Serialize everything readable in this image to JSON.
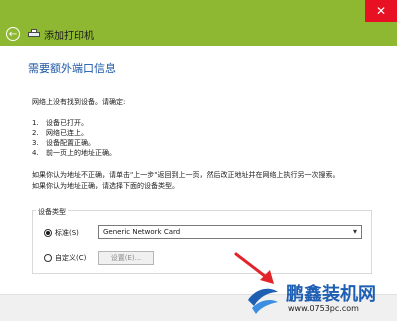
{
  "window": {
    "close_glyph": "✕",
    "title": "添加打印机",
    "titlebar_color": "#8fb832"
  },
  "nav": {
    "back_glyph": "←"
  },
  "page": {
    "heading": "需要额外端口信息",
    "intro": "网络上没有找到设备。请确定:",
    "checklist": [
      {
        "num": "1.",
        "text": "设备已打开。"
      },
      {
        "num": "2.",
        "text": "网络已连上。"
      },
      {
        "num": "3.",
        "text": "设备配置正确。"
      },
      {
        "num": "4.",
        "text": "前一页上的地址正确。"
      }
    ],
    "note_line1": "如果你认为地址不正确，请单击\"上一步\"返回到上一页，然后改正地址并在网络上执行另一次搜索。",
    "note_line2": "如果你认为地址正确，请选择下面的设备类型。"
  },
  "device_type": {
    "group_label": "设备类型",
    "standard_label": "标准(S)",
    "standard_selected": true,
    "custom_label": "自定义(C)",
    "custom_selected": false,
    "select_value": "Generic Network Card",
    "settings_button": "设置(E)..."
  },
  "watermark": {
    "brand": "鹏鑫装机网",
    "url": "www.0753pc.com",
    "brand_color": "#1e5fb3"
  }
}
